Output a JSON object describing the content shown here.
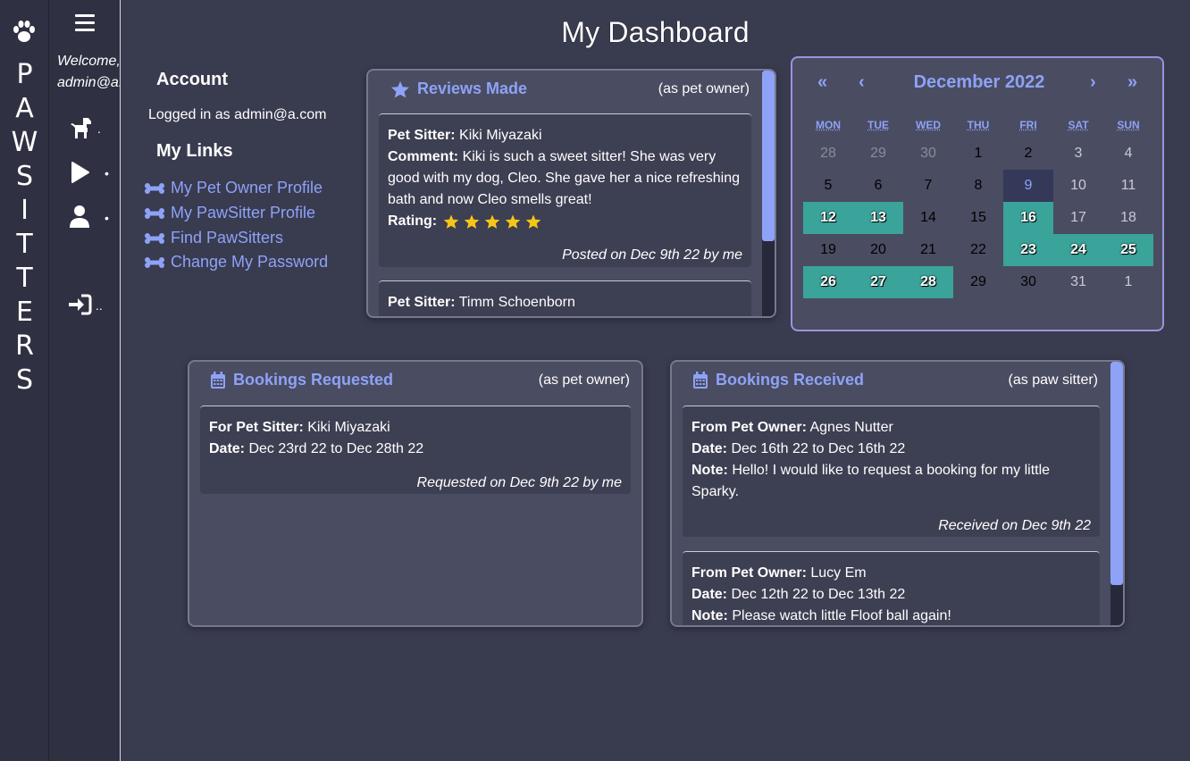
{
  "brand": {
    "letters": [
      "P",
      "A",
      "W",
      "S",
      "I",
      "T",
      "T",
      "E",
      "R",
      "S"
    ]
  },
  "nav": {
    "welcome_line1": "Welcome,",
    "welcome_line2": "admin@a.com"
  },
  "page_title": "My Dashboard",
  "account": {
    "heading": "Account",
    "logged_in": "Logged in as admin@a.com",
    "links_heading": "My Links",
    "links": [
      {
        "label": "My Pet Owner Profile",
        "icon": "bone-icon"
      },
      {
        "label": "My PawSitter Profile",
        "icon": "bone-icon"
      },
      {
        "label": "Find PawSitters",
        "icon": "bone-icon"
      },
      {
        "label": "Change My Password",
        "icon": "bone-icon"
      }
    ]
  },
  "reviews": {
    "title": "Reviews Made",
    "subtitle": "(as pet owner)",
    "items": [
      {
        "sitter_label": "Pet Sitter:",
        "sitter": "Kiki Miyazaki",
        "comment_label": "Comment:",
        "comment": "Kiki is such a sweet sitter! She was very good with my dog, Cleo. She gave her a nice refreshing bath and now Cleo smells great!",
        "rating_label": "Rating:",
        "rating": 5,
        "footer": "Posted on Dec 9th 22 by me"
      },
      {
        "sitter_label": "Pet Sitter:",
        "sitter": "Timm Schoenborn"
      }
    ]
  },
  "calendar": {
    "month": "December 2022",
    "prev_year": "«",
    "prev_month": "‹",
    "next_month": "›",
    "next_year": "»",
    "weekdays": [
      "MON",
      "TUE",
      "WED",
      "THU",
      "FRI",
      "SAT",
      "SUN"
    ],
    "weeks": [
      [
        "28",
        "29",
        "30",
        "1",
        "2",
        "3",
        "4"
      ],
      [
        "5",
        "6",
        "7",
        "8",
        "9",
        "10",
        "11"
      ],
      [
        "12",
        "13",
        "14",
        "15",
        "16",
        "17",
        "18"
      ],
      [
        "19",
        "20",
        "21",
        "22",
        "23",
        "24",
        "25"
      ],
      [
        "26",
        "27",
        "28",
        "29",
        "30",
        "31",
        "1"
      ]
    ],
    "booked_color": "#3aa39a"
  },
  "bookings_requested": {
    "title": "Bookings Requested",
    "subtitle": "(as pet owner)",
    "items": [
      {
        "sitter_label": "For Pet Sitter:",
        "sitter": "Kiki Miyazaki",
        "date_label": "Date:",
        "date": "Dec 23rd 22 to Dec 28th 22",
        "footer": "Requested on Dec 9th 22 by me"
      }
    ]
  },
  "bookings_received": {
    "title": "Bookings Received",
    "subtitle": "(as paw sitter)",
    "items": [
      {
        "owner_label": "From Pet Owner:",
        "owner": "Agnes Nutter",
        "date_label": "Date:",
        "date": "Dec 16th 22 to Dec 16th 22",
        "note_label": "Note:",
        "note": "Hello! I would like to request a booking for my little Sparky.",
        "footer": "Received on Dec 9th 22"
      },
      {
        "owner_label": "From Pet Owner:",
        "owner": "Lucy Em",
        "date_label": "Date:",
        "date": "Dec 12th 22 to Dec 13th 22",
        "note_label": "Note:",
        "note": "Please watch little Floof ball again!"
      }
    ]
  },
  "colors": {
    "accent": "#8ea2f7",
    "star": "#f5c518",
    "background": "#393b4f"
  }
}
